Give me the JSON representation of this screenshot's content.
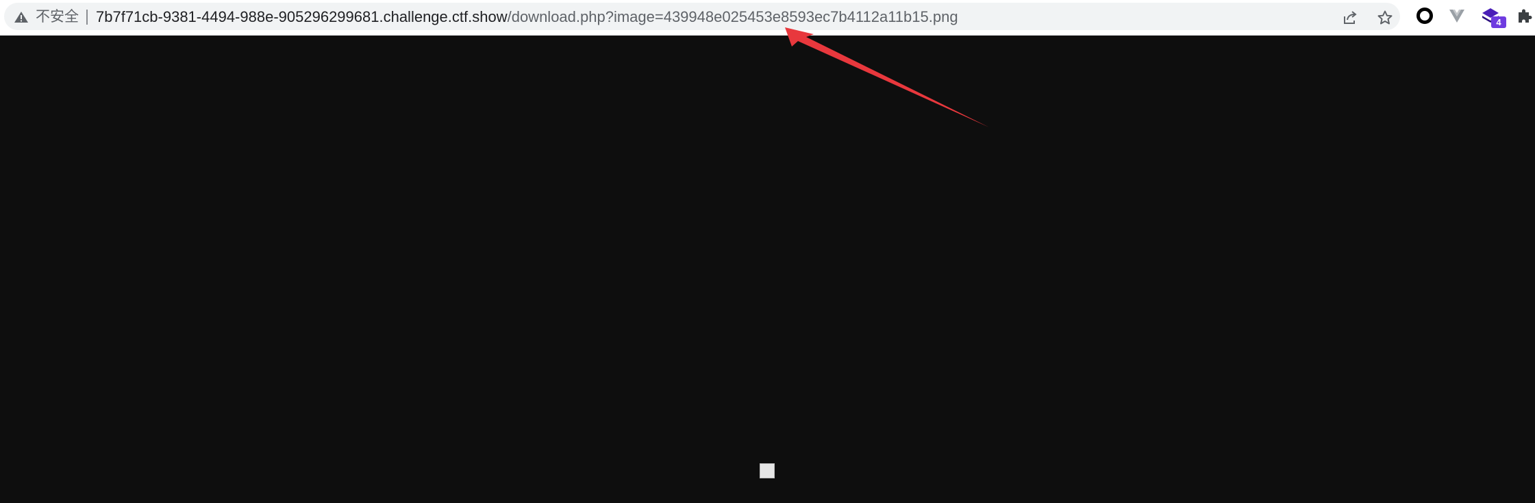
{
  "addressbar": {
    "security_label": "不安全",
    "url_host": "7b7f71cb-9381-4494-988e-905296299681.challenge.ctf.show",
    "url_path": "/download.php?image=439948e025453e8593ec7b4112a11b15.png"
  },
  "icons": {
    "security": "warning-triangle-icon",
    "share": "share-icon",
    "bookmark": "star-icon",
    "ext_1": "circle-extension-icon",
    "ext_2": "vue-devtools-icon",
    "ext_3": "stack-extension-icon",
    "ext_4": "puzzle-extensions-icon"
  },
  "extensions": {
    "badge_count": "4"
  },
  "colors": {
    "page_background": "#0e0e0e",
    "annotation_arrow": "#e8383d",
    "badge": "#6f3ce0"
  }
}
